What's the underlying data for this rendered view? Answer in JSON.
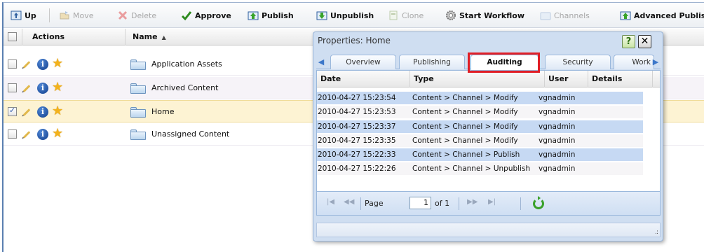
{
  "toolbar": {
    "up": "Up",
    "move": "Move",
    "delete": "Delete",
    "approve": "Approve",
    "publish": "Publish",
    "unpublish": "Unpublish",
    "clone": "Clone",
    "start_workflow": "Start Workflow",
    "channels": "Channels",
    "advanced_publish": "Advanced Publish"
  },
  "grid": {
    "col_actions": "Actions",
    "col_name": "Name",
    "sort_indicator": "▲",
    "rows": [
      {
        "name": "Application Assets",
        "checked": false,
        "selected": false
      },
      {
        "name": "Archived Content",
        "checked": false,
        "selected": false
      },
      {
        "name": "Home",
        "checked": true,
        "selected": true
      },
      {
        "name": "Unassigned Content",
        "checked": false,
        "selected": false
      }
    ]
  },
  "dialog": {
    "title": "Properties: Home",
    "help": "?",
    "close": "✕",
    "tabs": [
      "Overview",
      "Publishing",
      "Auditing",
      "Security",
      "Work"
    ],
    "active_tab": "Auditing",
    "columns": [
      "Date",
      "Type",
      "User",
      "Details"
    ],
    "rows": [
      {
        "date": "2010-04-27 15:23:54",
        "type": "Content > Channel > Modify",
        "user": "vgnadmin",
        "details": ""
      },
      {
        "date": "2010-04-27 15:23:53",
        "type": "Content > Channel > Modify",
        "user": "vgnadmin",
        "details": ""
      },
      {
        "date": "2010-04-27 15:23:37",
        "type": "Content > Channel > Modify",
        "user": "vgnadmin",
        "details": ""
      },
      {
        "date": "2010-04-27 15:23:35",
        "type": "Content > Channel > Modify",
        "user": "vgnadmin",
        "details": ""
      },
      {
        "date": "2010-04-27 15:22:33",
        "type": "Content > Channel > Publish",
        "user": "vgnadmin",
        "details": ""
      },
      {
        "date": "2010-04-27 15:22:26",
        "type": "Content > Channel > Unpublish",
        "user": "vgnadmin",
        "details": ""
      }
    ],
    "pager": {
      "page_label": "Page",
      "page_value": "1",
      "of_label": "of 1"
    }
  },
  "colors": {
    "accent_blue": "#c6d9f3",
    "selected_row": "#fdf3d3",
    "highlight_red": "#e01e26"
  }
}
